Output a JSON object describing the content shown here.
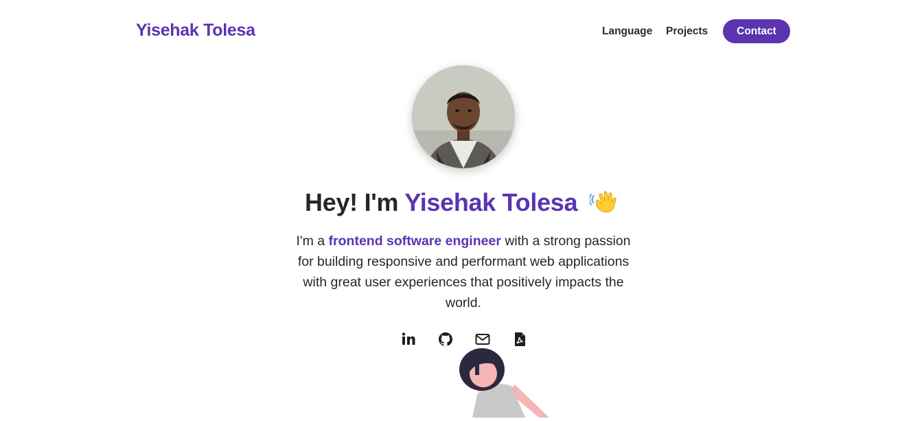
{
  "nav": {
    "brand": "Yisehak Tolesa",
    "links": [
      {
        "label": "Language"
      },
      {
        "label": "Projects"
      }
    ],
    "contact_label": "Contact"
  },
  "hero": {
    "greeting": "Hey! I'm",
    "name": "Yisehak Tolesa",
    "wave_icon": "waving-hand-icon",
    "bio_prefix": "I'm a",
    "bio_highlight": "frontend software engineer",
    "bio_suffix": "with a strong passion for building responsive and performant web applications with great user experiences that positively impacts the world."
  },
  "socials": [
    {
      "icon": "linkedin-icon"
    },
    {
      "icon": "github-icon"
    },
    {
      "icon": "mail-icon"
    },
    {
      "icon": "pdf-icon"
    }
  ],
  "colors": {
    "accent": "#5b34b0",
    "text": "#262626",
    "background": "#ffffff"
  }
}
